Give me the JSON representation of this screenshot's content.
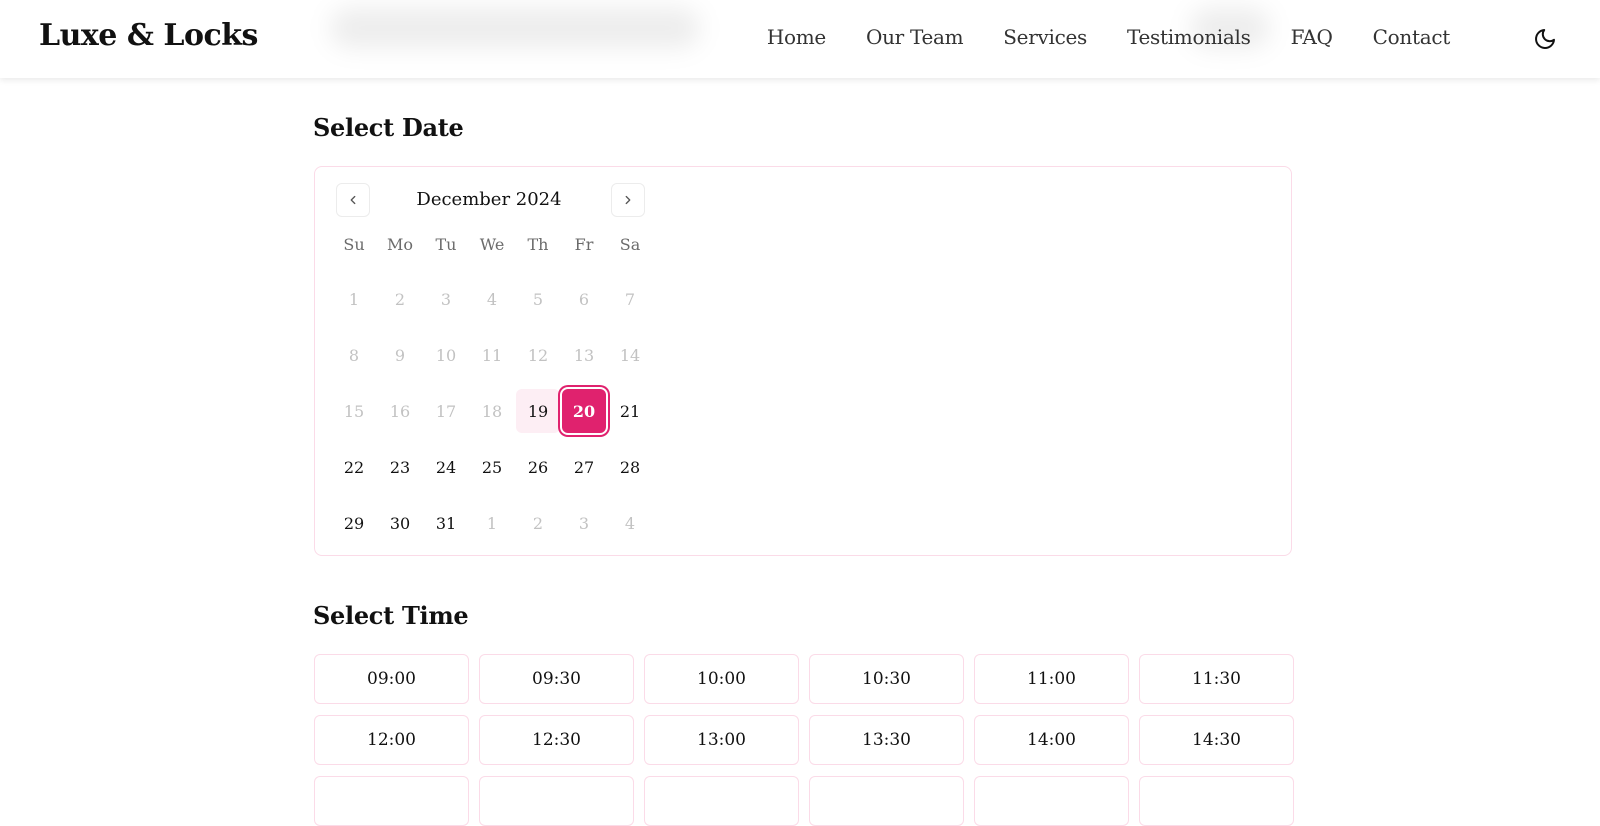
{
  "header": {
    "brand": "Luxe & Locks",
    "nav": [
      "Home",
      "Our Team",
      "Services",
      "Testimonials",
      "FAQ",
      "Contact"
    ],
    "theme_icon": "moon-icon"
  },
  "date_section": {
    "title": "Select Date",
    "month_label": "December 2024",
    "prev_icon": "chevron-left-icon",
    "next_icon": "chevron-right-icon",
    "weekdays": [
      "Su",
      "Mo",
      "Tu",
      "We",
      "Th",
      "Fr",
      "Sa"
    ],
    "days": [
      {
        "label": "1",
        "state": "disabled"
      },
      {
        "label": "2",
        "state": "disabled"
      },
      {
        "label": "3",
        "state": "disabled"
      },
      {
        "label": "4",
        "state": "disabled"
      },
      {
        "label": "5",
        "state": "disabled"
      },
      {
        "label": "6",
        "state": "disabled"
      },
      {
        "label": "7",
        "state": "disabled"
      },
      {
        "label": "8",
        "state": "disabled"
      },
      {
        "label": "9",
        "state": "disabled"
      },
      {
        "label": "10",
        "state": "disabled"
      },
      {
        "label": "11",
        "state": "disabled"
      },
      {
        "label": "12",
        "state": "disabled"
      },
      {
        "label": "13",
        "state": "disabled"
      },
      {
        "label": "14",
        "state": "disabled"
      },
      {
        "label": "15",
        "state": "disabled"
      },
      {
        "label": "16",
        "state": "disabled"
      },
      {
        "label": "17",
        "state": "disabled"
      },
      {
        "label": "18",
        "state": "disabled"
      },
      {
        "label": "19",
        "state": "today"
      },
      {
        "label": "20",
        "state": "selected"
      },
      {
        "label": "21",
        "state": "active"
      },
      {
        "label": "22",
        "state": "active"
      },
      {
        "label": "23",
        "state": "active"
      },
      {
        "label": "24",
        "state": "active"
      },
      {
        "label": "25",
        "state": "active"
      },
      {
        "label": "26",
        "state": "active"
      },
      {
        "label": "27",
        "state": "active"
      },
      {
        "label": "28",
        "state": "active"
      },
      {
        "label": "29",
        "state": "active"
      },
      {
        "label": "30",
        "state": "active"
      },
      {
        "label": "31",
        "state": "active"
      },
      {
        "label": "1",
        "state": "outside"
      },
      {
        "label": "2",
        "state": "outside"
      },
      {
        "label": "3",
        "state": "outside"
      },
      {
        "label": "4",
        "state": "outside"
      }
    ]
  },
  "time_section": {
    "title": "Select Time",
    "slots": [
      "09:00",
      "09:30",
      "10:00",
      "10:30",
      "11:00",
      "11:30",
      "12:00",
      "12:30",
      "13:00",
      "13:30",
      "14:00",
      "14:30",
      "",
      "",
      "",
      "",
      "",
      ""
    ]
  },
  "colors": {
    "accent": "#e0226e",
    "accent_soft": "#fdeef4",
    "border": "#fbdbe8"
  }
}
